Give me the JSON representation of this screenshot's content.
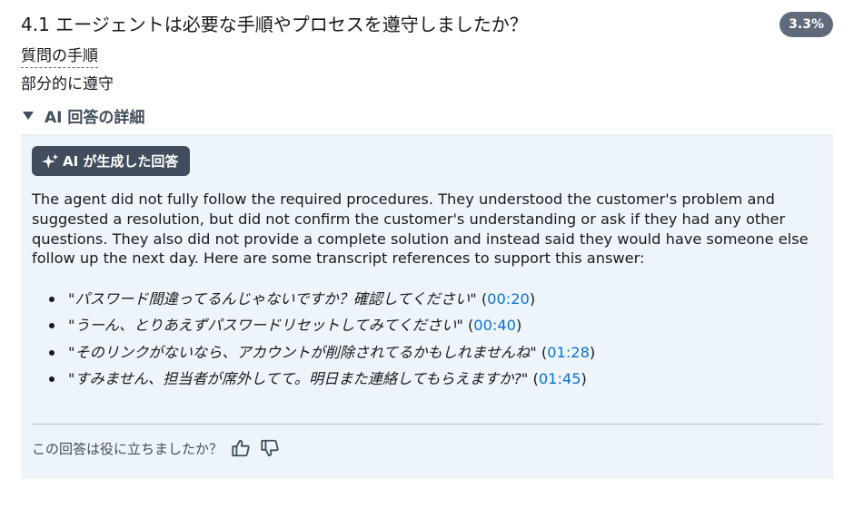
{
  "question": {
    "title": "4.1 エージェントは必要な手順やプロセスを遵守しましたか？",
    "score": "3.3%",
    "type_label": "質問の手順",
    "answer": "部分的に遵守"
  },
  "details": {
    "toggle_label": "AI 回答の詳細",
    "ai_badge_label": "AI が生成した回答",
    "summary": "The agent did not fully follow the required procedures. They understood the customer's problem and suggested a resolution, but did not confirm the customer's understanding or ask if they had any other questions. They also did not provide a complete solution and instead said they would have someone else follow up the next day. Here are some transcript references to support this answer:",
    "references": [
      {
        "quote": "\"パスワード間違ってるんじゃないですか？確認してください\"",
        "time": "00:20"
      },
      {
        "quote": "\"うーん、とりあえずパスワードリセットしてみてください\"",
        "time": "00:40"
      },
      {
        "quote": "\"そのリンクがないなら、アカウントが削除されてるかもしれませんね\"",
        "time": "01:28"
      },
      {
        "quote": "\"すみません、担当者が席外してて。明日また連絡してもらえますか?\"",
        "time": "01:45"
      }
    ],
    "ref_open": "(",
    "ref_close": ")"
  },
  "feedback": {
    "prompt": "この回答は役に立ちましたか？"
  },
  "icons": {
    "toggle": "caret-down-icon",
    "ai": "sparkle-icon",
    "like": "thumbs-up-icon",
    "dislike": "thumbs-down-icon"
  },
  "colors": {
    "badge_bg": "#5f6b7a",
    "ai_badge_bg": "#414d5c",
    "panel_bg": "#eef5fa",
    "link": "#0972d3"
  }
}
